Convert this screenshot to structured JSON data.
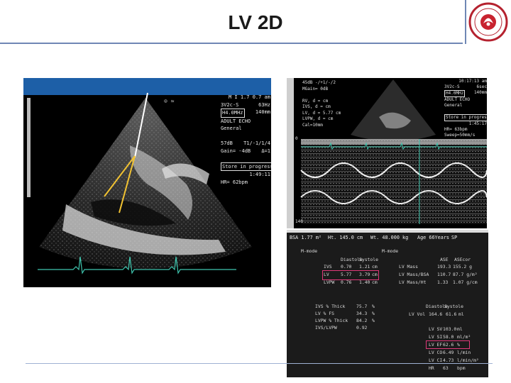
{
  "slide": {
    "title": "LV 2D"
  },
  "left_image": {
    "icon_glyph": "⊙ ≃",
    "info_lines": [
      [
        "",
        "M I 1.7  0.7 am"
      ],
      [
        "3V2c-S",
        "63Hz"
      ],
      [
        "H4.0MHz",
        "140mm"
      ],
      [
        "ADULT ECHO",
        ""
      ],
      [
        "General",
        ""
      ],
      [
        "",
        ""
      ],
      [
        "57dB",
        "T1/-1/1/4"
      ],
      [
        "Gain= -4dB",
        "Δ=1"
      ],
      [
        "",
        ""
      ],
      [
        "Store in progress",
        ""
      ],
      [
        "",
        "1:49:11"
      ],
      [
        "HR= 62bpm",
        ""
      ]
    ]
  },
  "right_top_image": {
    "topleft_lines": [
      "45dB -/+1/-/2",
      "MGain= 0dB",
      "",
      "RV, d = cm",
      "IVS, d = cm",
      "LV, d = 5.77 cm",
      "LVPW, d = cm",
      "Cal=10mm"
    ],
    "info_lines": [
      [
        "",
        "10:17:13 am"
      ],
      [
        "3V2c-S",
        "6sec"
      ],
      [
        "H4.0MHz",
        "140mm"
      ],
      [
        "ADULT ECHO",
        ""
      ],
      [
        "General",
        ""
      ],
      [
        "",
        ""
      ],
      [
        "Store in progress",
        ""
      ],
      [
        "",
        "1:45:17"
      ],
      [
        "HR= 63bpm",
        ""
      ],
      [
        "Sweep=50mm/s",
        ""
      ]
    ],
    "axis_top": "0",
    "axis_bottom": "140"
  },
  "report": {
    "header": [
      "BSA 1.77 m²",
      "Ht. 145.0 cm",
      "Wt. 48.000 kg",
      "Age 66Years",
      "SP"
    ],
    "left_section_title": "M-mode",
    "left_col_heads": [
      "Diastole",
      "Systole"
    ],
    "left_rows": [
      [
        "IVS",
        "0.70",
        "1.21",
        "cm"
      ],
      [
        "LV",
        "5.77",
        "3.79",
        "cm"
      ],
      [
        "LVPW",
        "0.76",
        "1.40",
        "cm"
      ]
    ],
    "pct_rows": [
      [
        "IVS % Thick",
        "75.7",
        "%"
      ],
      [
        "LV % FS",
        "34.3",
        "%"
      ],
      [
        "LVPW % Thick",
        "84.2",
        "%"
      ],
      [
        "IVS/LVPW",
        "0.92",
        ""
      ]
    ],
    "right_section_title": "M-mode",
    "right_col_heads": [
      "ASE",
      "ASEcor"
    ],
    "mass_rows": [
      [
        "LV Mass",
        "193.3",
        "155.2 g"
      ],
      [
        "LV Mass/BSA",
        "110.7",
        "87.7 g/m²"
      ],
      [
        "LV Mass/Ht",
        "1.33",
        "1.07 g/cm"
      ]
    ],
    "vol_col_heads": [
      "Diastole",
      "Systole"
    ],
    "vol_row": [
      "LV Vol",
      "164.6",
      "61.6",
      "ml"
    ],
    "flow_rows": [
      [
        "LV SV",
        "103.0",
        "ml"
      ],
      [
        "LV SI",
        "58.0",
        "ml/m²"
      ],
      [
        "LV EF",
        "62.6",
        "%"
      ],
      [
        "LV CO",
        "6.49",
        "l/min"
      ],
      [
        "LV CI",
        "4.73",
        "l/min/m²"
      ],
      [
        "HR",
        "63",
        "bpm"
      ]
    ],
    "highlight_color": "#e0397a"
  },
  "colors": {
    "rule": "#6f87b5",
    "ultrasound_bar": "#1d5fa7",
    "annotation_yellow": "#f1c232",
    "ecg_trace": "#3fc7b0"
  }
}
